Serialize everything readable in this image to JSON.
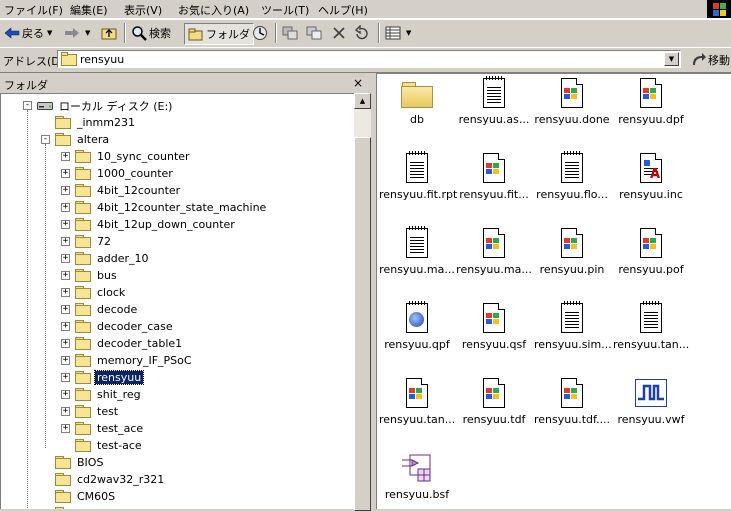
{
  "menu": {
    "items": [
      "ファイル(F)",
      "編集(E)",
      "表示(V)",
      "お気に入り(A)",
      "ツール(T)",
      "ヘルプ(H)"
    ]
  },
  "toolbar": {
    "back_label": "戻る",
    "search_label": "検索",
    "folders_label": "フォルダ"
  },
  "address": {
    "label": "アドレス(D)",
    "value": "rensyuu",
    "go_label": "移動"
  },
  "folder_pane": {
    "title": "フォルダ",
    "close": "×"
  },
  "tree": [
    {
      "label": "ローカル ディスク (E:)",
      "level": 0,
      "expander": "minus",
      "icon": "drive"
    },
    {
      "label": "_inmm231",
      "level": 1,
      "expander": "none",
      "icon": "folder"
    },
    {
      "label": "altera",
      "level": 1,
      "expander": "minus",
      "icon": "folder"
    },
    {
      "label": "10_sync_counter",
      "level": 2,
      "expander": "plus",
      "icon": "folder"
    },
    {
      "label": "1000_counter",
      "level": 2,
      "expander": "plus",
      "icon": "folder"
    },
    {
      "label": "4bit_12counter",
      "level": 2,
      "expander": "plus",
      "icon": "folder"
    },
    {
      "label": "4bit_12counter_state_machine",
      "level": 2,
      "expander": "plus",
      "icon": "folder"
    },
    {
      "label": "4bit_12up_down_counter",
      "level": 2,
      "expander": "plus",
      "icon": "folder"
    },
    {
      "label": "72",
      "level": 2,
      "expander": "plus",
      "icon": "folder"
    },
    {
      "label": "adder_10",
      "level": 2,
      "expander": "plus",
      "icon": "folder"
    },
    {
      "label": "bus",
      "level": 2,
      "expander": "plus",
      "icon": "folder"
    },
    {
      "label": "clock",
      "level": 2,
      "expander": "plus",
      "icon": "folder"
    },
    {
      "label": "decode",
      "level": 2,
      "expander": "plus",
      "icon": "folder"
    },
    {
      "label": "decoder_case",
      "level": 2,
      "expander": "plus",
      "icon": "folder"
    },
    {
      "label": "decoder_table1",
      "level": 2,
      "expander": "plus",
      "icon": "folder"
    },
    {
      "label": "memory_IF_PSoC",
      "level": 2,
      "expander": "plus",
      "icon": "folder"
    },
    {
      "label": "rensyuu",
      "level": 2,
      "expander": "plus",
      "icon": "folder-open",
      "selected": true
    },
    {
      "label": "shit_reg",
      "level": 2,
      "expander": "plus",
      "icon": "folder"
    },
    {
      "label": "test",
      "level": 2,
      "expander": "plus",
      "icon": "folder"
    },
    {
      "label": "test_ace",
      "level": 2,
      "expander": "plus",
      "icon": "folder"
    },
    {
      "label": "test-ace",
      "level": 2,
      "expander": "none",
      "icon": "folder"
    },
    {
      "label": "BIOS",
      "level": 1,
      "expander": "none",
      "icon": "folder"
    },
    {
      "label": "cd2wav32_r321",
      "level": 1,
      "expander": "none",
      "icon": "folder"
    },
    {
      "label": "CM60S",
      "level": 1,
      "expander": "none",
      "icon": "folder"
    },
    {
      "label": "",
      "level": 1,
      "expander": "none",
      "icon": "folder"
    }
  ],
  "files": [
    {
      "name": "db",
      "icon": "folder-icon"
    },
    {
      "name": "rensyuu.as...",
      "icon": "text-document-icon"
    },
    {
      "name": "rensyuu.done",
      "icon": "windows-file-icon"
    },
    {
      "name": "rensyuu.dpf",
      "icon": "windows-file-icon"
    },
    {
      "name": "rensyuu.fit.rpt",
      "icon": "notepad-document-icon"
    },
    {
      "name": "rensyuu.fit...",
      "icon": "windows-file-icon"
    },
    {
      "name": "rensyuu.flo...",
      "icon": "text-document-icon"
    },
    {
      "name": "rensyuu.inc",
      "icon": "include-file-icon"
    },
    {
      "name": "rensyuu.ma...",
      "icon": "notepad-document-icon"
    },
    {
      "name": "rensyuu.ma...",
      "icon": "windows-file-icon"
    },
    {
      "name": "rensyuu.pin",
      "icon": "windows-file-icon"
    },
    {
      "name": "rensyuu.pof",
      "icon": "windows-file-icon"
    },
    {
      "name": "rensyuu.qpf",
      "icon": "quartus-project-icon"
    },
    {
      "name": "rensyuu.qsf",
      "icon": "windows-file-icon"
    },
    {
      "name": "rensyuu.sim...",
      "icon": "text-document-icon"
    },
    {
      "name": "rensyuu.tan...",
      "icon": "notepad-document-icon"
    },
    {
      "name": "rensyuu.tan...",
      "icon": "windows-file-icon"
    },
    {
      "name": "rensyuu.tdf",
      "icon": "windows-file-icon"
    },
    {
      "name": "rensyuu.tdf....",
      "icon": "windows-file-icon"
    },
    {
      "name": "rensyuu.vwf",
      "icon": "waveform-icon"
    },
    {
      "name": "rensyuu.bsf",
      "icon": "block-symbol-icon"
    }
  ],
  "colors": {
    "chrome": "#d4d0c8",
    "selection": "#0a246a",
    "folder": "#f7e495"
  }
}
